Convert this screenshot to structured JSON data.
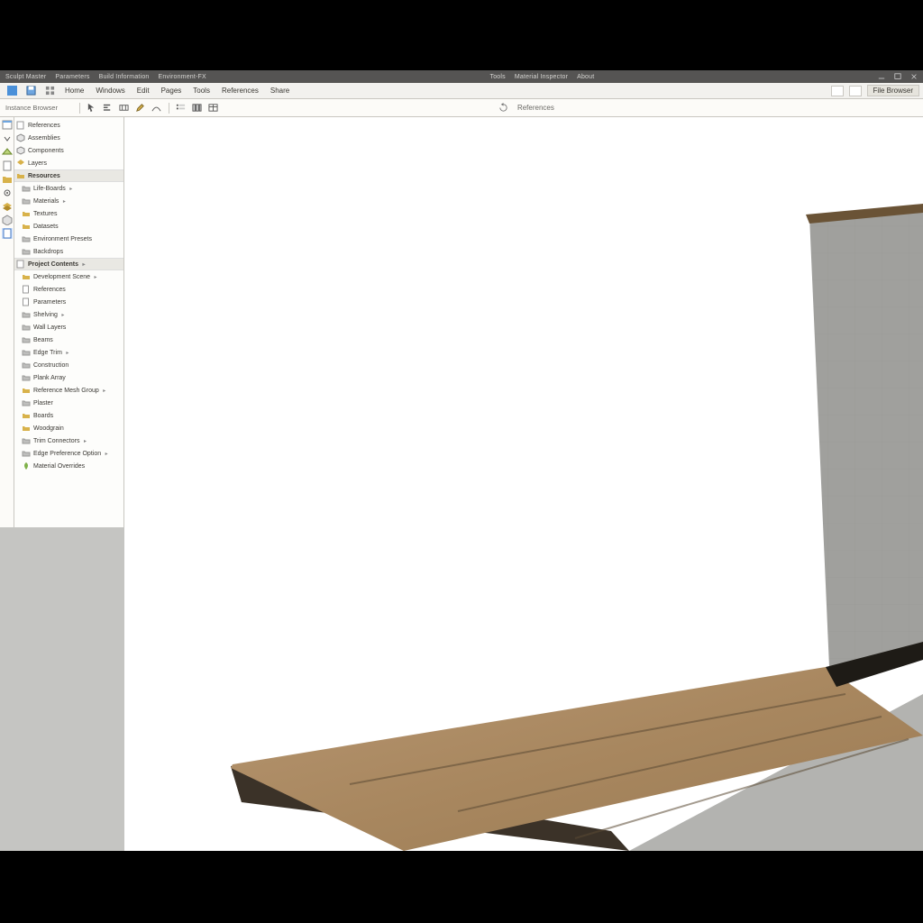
{
  "titlebar": {
    "items_left": [
      "Sculpt Master",
      "Parameters",
      "Build Information",
      "Environment-FX"
    ],
    "items_right": [
      "Tools",
      "Material Inspector",
      "About"
    ]
  },
  "menubar": {
    "items": [
      "Home",
      "Windows",
      "Edit",
      "Pages",
      "Tools",
      "References",
      "Share"
    ],
    "right_button": "File Browser"
  },
  "toolstrip": {
    "panel_label": "Instance Browser",
    "secondary_label": "References"
  },
  "tree": {
    "roots": [
      {
        "icon": "doc",
        "label": "References"
      },
      {
        "icon": "cube",
        "label": "Assemblies"
      },
      {
        "icon": "cube",
        "label": "Components"
      },
      {
        "icon": "layers",
        "label": "Layers"
      }
    ],
    "section1_header": "Resources",
    "section1": [
      {
        "icon": "folder-grey",
        "label": "Life-Boards",
        "sub": true
      },
      {
        "icon": "folder-grey",
        "label": "Materials",
        "sub": true
      },
      {
        "icon": "folder",
        "label": "Textures"
      },
      {
        "icon": "folder",
        "label": "Datasets"
      },
      {
        "icon": "folder-grey",
        "label": "Environment Presets"
      },
      {
        "icon": "folder-grey",
        "label": "Backdrops"
      }
    ],
    "section2_header": "Project Contents",
    "section2": [
      {
        "icon": "folder",
        "label": "Development Scene",
        "sub": true
      },
      {
        "icon": "doc",
        "label": "References"
      },
      {
        "icon": "doc",
        "label": "Parameters"
      },
      {
        "icon": "folder-grey",
        "label": "Shelving",
        "sub": true
      },
      {
        "icon": "folder-grey",
        "label": "Wall Layers"
      },
      {
        "icon": "folder-grey",
        "label": "Beams"
      },
      {
        "icon": "folder-grey",
        "label": "Edge Trim",
        "sub": true
      },
      {
        "icon": "folder-grey",
        "label": "Construction"
      },
      {
        "icon": "folder-grey",
        "label": "Plank Array"
      },
      {
        "icon": "folder",
        "label": "Reference Mesh Group",
        "sub": true
      },
      {
        "icon": "folder-grey",
        "label": "Plaster"
      },
      {
        "icon": "folder",
        "label": "Boards"
      },
      {
        "icon": "folder",
        "label": "Woodgrain"
      },
      {
        "icon": "folder-grey",
        "label": "Trim Connectors",
        "sub": true
      },
      {
        "icon": "folder-grey",
        "label": "Edge Preference Option",
        "sub": true
      },
      {
        "icon": "leaf",
        "label": "Material Overrides"
      }
    ]
  },
  "colors": {
    "accent": "#d8b24a",
    "selection": "#cfe1fb"
  }
}
